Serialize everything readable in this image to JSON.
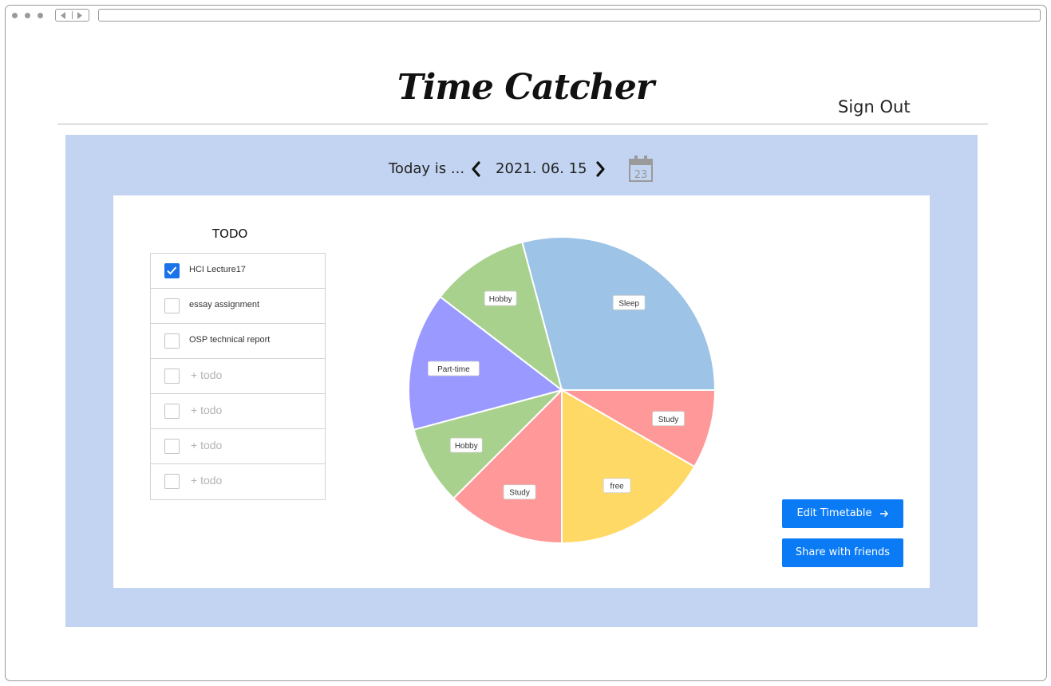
{
  "header": {
    "title": "Time Catcher",
    "sign_out_label": "Sign Out"
  },
  "date_nav": {
    "today_label": "Today is ...",
    "date": "2021. 06. 15",
    "calendar_day": "23"
  },
  "todo": {
    "title": "TODO",
    "items": [
      {
        "label": "HCI Lecture17",
        "checked": true
      },
      {
        "label": "essay assignment",
        "checked": false
      },
      {
        "label": "OSP technical report",
        "checked": false
      },
      {
        "label": "+ todo",
        "checked": false,
        "placeholder": true
      },
      {
        "label": "+ todo",
        "checked": false,
        "placeholder": true
      },
      {
        "label": "+ todo",
        "checked": false,
        "placeholder": true
      },
      {
        "label": "+ todo",
        "checked": false,
        "placeholder": true
      }
    ]
  },
  "buttons": {
    "edit_label": "Edit Timetable",
    "share_label": "Share with friends"
  },
  "chart_data": {
    "type": "pie",
    "start_angle_deg": -15,
    "slices": [
      {
        "label": "Sleep",
        "value": 7.0,
        "color": "#9dc3e6"
      },
      {
        "label": "Study",
        "value": 2.0,
        "color": "#ff9999"
      },
      {
        "label": "free",
        "value": 4.0,
        "color": "#ffd966"
      },
      {
        "label": "Study",
        "value": 3.0,
        "color": "#ff9999"
      },
      {
        "label": "Hobby",
        "value": 2.0,
        "color": "#a9d18e"
      },
      {
        "label": "Part-time",
        "value": 3.5,
        "color": "#9999ff"
      },
      {
        "label": "Hobby",
        "value": 2.5,
        "color": "#a9d18e"
      }
    ]
  },
  "colors": {
    "panel_bg": "#c2d4f1",
    "accent": "#0a7bf5"
  }
}
